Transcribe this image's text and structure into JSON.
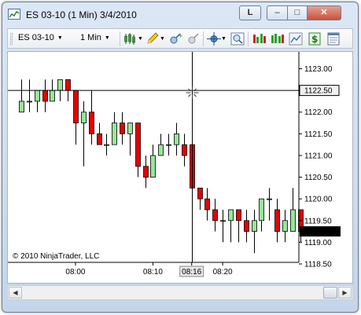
{
  "window": {
    "title": "ES 03-10 (1 Min)  3/4/2010",
    "buttons": {
      "link": "L",
      "minimize": "–",
      "maximize": "□",
      "close": "✕"
    }
  },
  "toolbar": {
    "instrument": "ES 03-10",
    "interval": "1 Min",
    "icons": [
      "candlestick-chart-icon",
      "pencil-icon",
      "add-indicator-icon",
      "remove-indicator-icon",
      "crosshair-icon",
      "zoom-icon",
      "indicators-icon",
      "strategies-icon",
      "chart-trader-icon",
      "dollar-icon",
      "properties-icon"
    ]
  },
  "colors": {
    "up_candle": "#98e698",
    "down_candle": "#e60000",
    "crosshair": "#000000",
    "marker_bg": "#000000",
    "marker_text": "#ffffff",
    "crosshair_price_bg": "#f0f0f0"
  },
  "chart": {
    "copyright": "© 2010 NinjaTrader, LLC",
    "crosshair_price": "1122.50",
    "last_price": "1119.25",
    "crosshair_time": "08:16",
    "crosshair_bar_index": 22
  },
  "chart_data": {
    "type": "candlestick",
    "title": "",
    "y_ticks": [
      "1123.00",
      "1122.50",
      "1122.00",
      "1121.50",
      "1121.00",
      "1120.50",
      "1120.00",
      "1119.50",
      "1119.00",
      "1118.50"
    ],
    "y_range": [
      1118.5,
      1123.0
    ],
    "x_ticks": [
      {
        "label": "08:00",
        "bar": 7
      },
      {
        "label": "08:10",
        "bar": 17
      },
      {
        "label": "08:16",
        "bar": 22
      },
      {
        "label": "08:20",
        "bar": 26
      }
    ],
    "grid": false,
    "bars": [
      {
        "o": 1122.0,
        "h": 1122.75,
        "l": 1122.0,
        "c": 1122.25
      },
      {
        "o": 1122.25,
        "h": 1122.75,
        "l": 1122.0,
        "c": 1122.25
      },
      {
        "o": 1122.25,
        "h": 1122.5,
        "l": 1122.0,
        "c": 1122.5
      },
      {
        "o": 1122.5,
        "h": 1122.75,
        "l": 1122.0,
        "c": 1122.25
      },
      {
        "o": 1122.25,
        "h": 1122.75,
        "l": 1122.25,
        "c": 1122.5
      },
      {
        "o": 1122.5,
        "h": 1122.75,
        "l": 1122.25,
        "c": 1122.75
      },
      {
        "o": 1122.75,
        "h": 1122.75,
        "l": 1122.25,
        "c": 1122.5
      },
      {
        "o": 1122.5,
        "h": 1122.5,
        "l": 1121.25,
        "c": 1121.75
      },
      {
        "o": 1121.75,
        "h": 1122.25,
        "l": 1120.75,
        "c": 1122.0
      },
      {
        "o": 1122.0,
        "h": 1122.5,
        "l": 1121.25,
        "c": 1121.5
      },
      {
        "o": 1121.5,
        "h": 1121.75,
        "l": 1121.25,
        "c": 1121.25
      },
      {
        "o": 1121.25,
        "h": 1121.5,
        "l": 1121.0,
        "c": 1121.25
      },
      {
        "o": 1121.25,
        "h": 1122.0,
        "l": 1121.25,
        "c": 1121.75
      },
      {
        "o": 1121.75,
        "h": 1122.0,
        "l": 1121.25,
        "c": 1121.5
      },
      {
        "o": 1121.5,
        "h": 1121.75,
        "l": 1121.0,
        "c": 1121.75
      },
      {
        "o": 1121.75,
        "h": 1121.75,
        "l": 1120.5,
        "c": 1120.75
      },
      {
        "o": 1120.75,
        "h": 1121.0,
        "l": 1120.25,
        "c": 1120.5
      },
      {
        "o": 1120.5,
        "h": 1121.25,
        "l": 1120.5,
        "c": 1121.0
      },
      {
        "o": 1121.0,
        "h": 1121.5,
        "l": 1121.0,
        "c": 1121.25
      },
      {
        "o": 1121.25,
        "h": 1121.5,
        "l": 1121.0,
        "c": 1121.25
      },
      {
        "o": 1121.25,
        "h": 1121.75,
        "l": 1121.0,
        "c": 1121.5
      },
      {
        "o": 1121.25,
        "h": 1121.5,
        "l": 1120.75,
        "c": 1121.0
      },
      {
        "o": 1121.25,
        "h": 1121.5,
        "l": 1119.75,
        "c": 1120.25
      },
      {
        "o": 1120.25,
        "h": 1120.25,
        "l": 1119.75,
        "c": 1120.0
      },
      {
        "o": 1120.0,
        "h": 1120.25,
        "l": 1119.5,
        "c": 1119.75
      },
      {
        "o": 1119.75,
        "h": 1120.0,
        "l": 1119.25,
        "c": 1119.5
      },
      {
        "o": 1119.5,
        "h": 1119.75,
        "l": 1119.0,
        "c": 1119.5
      },
      {
        "o": 1119.5,
        "h": 1119.75,
        "l": 1119.0,
        "c": 1119.75
      },
      {
        "o": 1119.75,
        "h": 1119.75,
        "l": 1119.0,
        "c": 1119.5
      },
      {
        "o": 1119.5,
        "h": 1119.75,
        "l": 1119.0,
        "c": 1119.25
      },
      {
        "o": 1119.25,
        "h": 1119.75,
        "l": 1118.75,
        "c": 1119.5
      },
      {
        "o": 1119.5,
        "h": 1120.0,
        "l": 1119.25,
        "c": 1120.0
      },
      {
        "o": 1120.0,
        "h": 1120.25,
        "l": 1119.5,
        "c": 1120.0
      },
      {
        "o": 1119.75,
        "h": 1120.0,
        "l": 1119.0,
        "c": 1119.25
      },
      {
        "o": 1119.25,
        "h": 1119.75,
        "l": 1119.0,
        "c": 1119.5
      },
      {
        "o": 1119.25,
        "h": 1120.25,
        "l": 1119.25,
        "c": 1119.75
      },
      {
        "o": 1119.75,
        "h": 1119.75,
        "l": 1119.0,
        "c": 1119.25
      }
    ]
  }
}
